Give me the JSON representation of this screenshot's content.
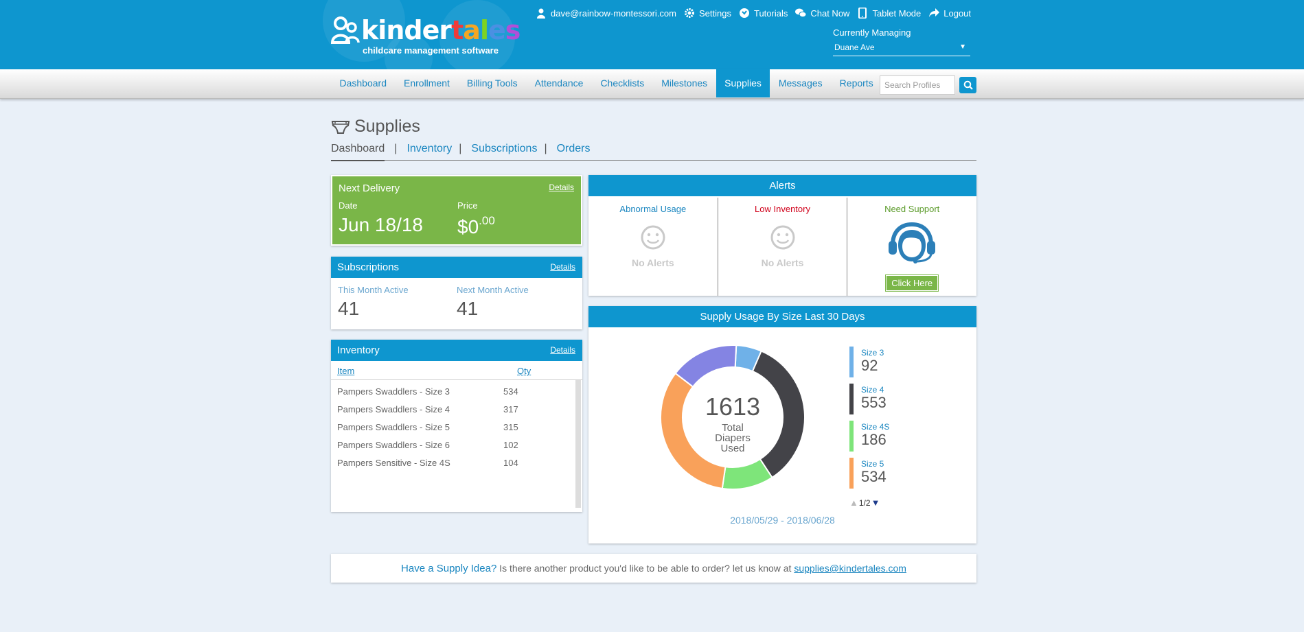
{
  "brand": {
    "logo_word": [
      "k",
      "i",
      "n",
      "d",
      "e",
      "r",
      "t",
      "a",
      "l",
      "e",
      "s"
    ],
    "logo_colors": [
      "#ffffff",
      "#ffffff",
      "#ffffff",
      "#ffffff",
      "#ffffff",
      "#ffffff",
      "#ef3b3b",
      "#f5a623",
      "#7ed321",
      "#4a90e2",
      "#b14fd8"
    ],
    "tagline": "childcare management software"
  },
  "userbar": {
    "email": "dave@rainbow-montessori.com",
    "settings": "Settings",
    "tutorials": "Tutorials",
    "chat": "Chat Now",
    "tablet": "Tablet Mode",
    "logout": "Logout"
  },
  "managing": {
    "label": "Currently Managing",
    "value": "Duane Ave"
  },
  "nav": {
    "items": [
      "Dashboard",
      "Enrollment",
      "Billing Tools",
      "Attendance",
      "Checklists",
      "Milestones",
      "Supplies",
      "Messages",
      "Reports"
    ],
    "active": "Supplies",
    "search_placeholder": "Search Profiles"
  },
  "page": {
    "title": "Supplies",
    "subnav": [
      "Dashboard",
      "Inventory",
      "Subscriptions",
      "Orders"
    ],
    "subnav_active": "Dashboard"
  },
  "delivery": {
    "title": "Next Delivery",
    "details": "Details",
    "date_label": "Date",
    "date_value": "Jun 18/18",
    "price_label": "Price",
    "price_main": "$0",
    "price_cents": ".00"
  },
  "subscriptions": {
    "title": "Subscriptions",
    "details": "Details",
    "this_label": "This Month Active",
    "this_value": "41",
    "next_label": "Next Month Active",
    "next_value": "41"
  },
  "inventory": {
    "title": "Inventory",
    "details": "Details",
    "col_item": "Item",
    "col_qty": "Qty",
    "rows": [
      {
        "item": "Pampers Swaddlers - Size 3",
        "qty": "534"
      },
      {
        "item": "Pampers Swaddlers - Size 4",
        "qty": "317"
      },
      {
        "item": "Pampers Swaddlers - Size 5",
        "qty": "315"
      },
      {
        "item": "Pampers Swaddlers - Size 6",
        "qty": "102"
      },
      {
        "item": "Pampers Sensitive - Size 4S",
        "qty": "104"
      }
    ]
  },
  "alerts": {
    "title": "Alerts",
    "abnormal": "Abnormal Usage",
    "abnormal_color": "#1a86c0",
    "abnormal_status": "No Alerts",
    "low": "Low Inventory",
    "low_color": "#d0021b",
    "low_status": "No Alerts",
    "support": "Need Support",
    "support_color": "#5b9b2a",
    "support_button": "Click Here"
  },
  "usage": {
    "title": "Supply Usage By Size Last 30 Days",
    "total": "1613",
    "caption": "Total Diapers Used",
    "pager": "1/2",
    "date_range": "2018/05/29 - 2018/06/28"
  },
  "chart_data": {
    "type": "pie",
    "title": "Supply Usage By Size Last 30 Days",
    "total": 1613,
    "series": [
      {
        "name": "Size 3",
        "value": 92,
        "color": "#6fb1e8"
      },
      {
        "name": "Size 4",
        "value": 553,
        "color": "#434348"
      },
      {
        "name": "Size 4S",
        "value": 186,
        "color": "#7ee57a"
      },
      {
        "name": "Size 5",
        "value": 534,
        "color": "#f9a15a"
      },
      {
        "name": "",
        "value": 248,
        "color": "#8484e3"
      }
    ],
    "legend_visible": [
      "Size 3",
      "Size 4",
      "Size 4S",
      "Size 5"
    ],
    "legend_position": "right"
  },
  "footer": {
    "lead": "Have a Supply Idea?",
    "text": " Is there another product you'd like to be able to order? let us know at ",
    "email": "supplies@kindertales.com"
  }
}
